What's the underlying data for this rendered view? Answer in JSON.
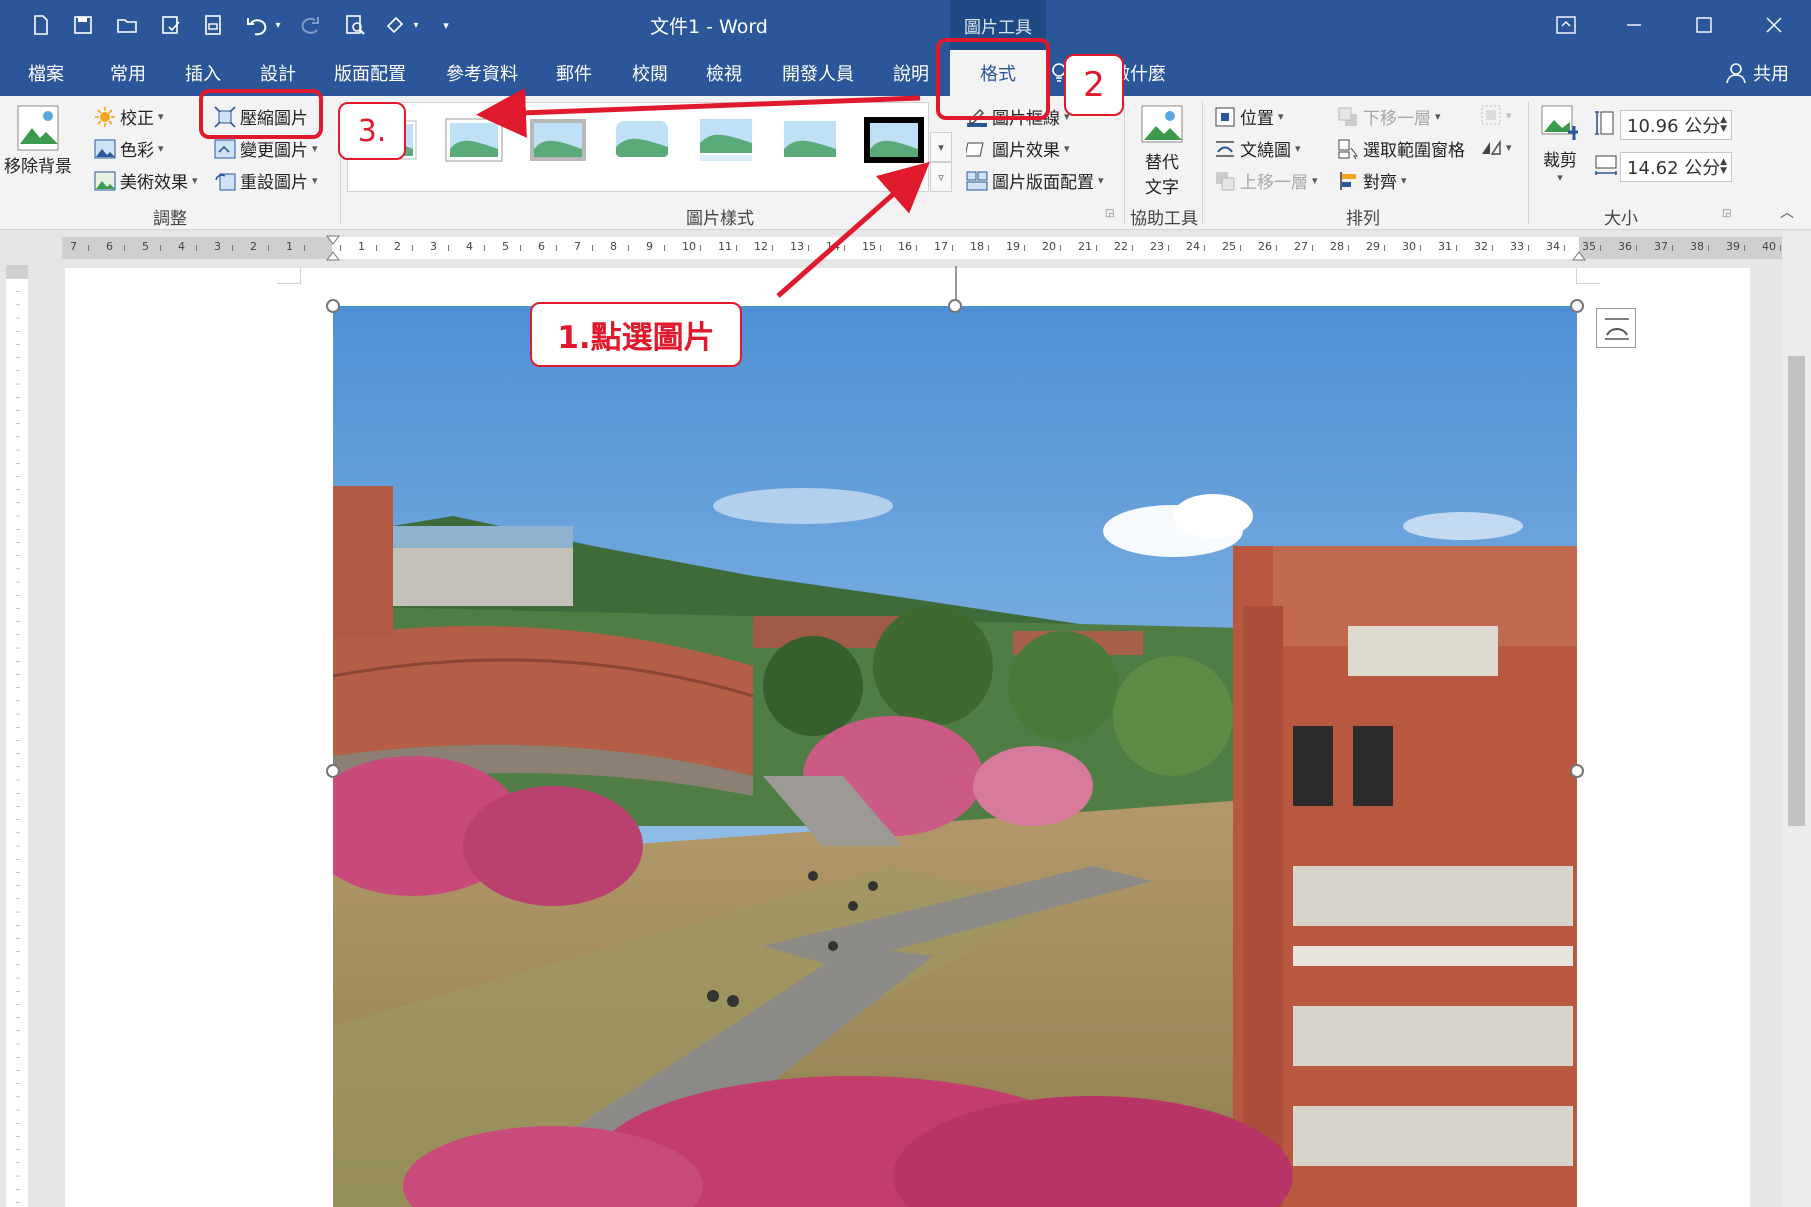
{
  "app": {
    "document_title": "文件1  -  Word",
    "tool_context": "圖片工具"
  },
  "tabs": [
    "檔案",
    "常用",
    "插入",
    "設計",
    "版面配置",
    "參考資料",
    "郵件",
    "校閱",
    "檢視",
    "開發人員",
    "說明",
    "格式"
  ],
  "active_tab": "格式",
  "tell_me": "您想做什麼",
  "share": "共用",
  "ribbon": {
    "adjust": {
      "remove_background": "移除背景",
      "corrections": "校正",
      "color": "色彩",
      "artistic": "美術效果",
      "compress": "壓縮圖片",
      "change": "變更圖片",
      "reset": "重設圖片",
      "label": "調整"
    },
    "styles": {
      "label": "圖片樣式",
      "border": "圖片框線",
      "effects": "圖片效果",
      "layout": "圖片版面配置"
    },
    "accessibility": {
      "alt_text_line1": "替代",
      "alt_text_line2": "文字",
      "label": "協助工具"
    },
    "arrange": {
      "position": "位置",
      "wrap": "文繞圖",
      "bring_forward": "上移一層",
      "send_backward": "下移一層",
      "selection_pane": "選取範圍窗格",
      "align": "對齊",
      "label": "排列"
    },
    "size": {
      "crop": "裁剪",
      "height": "10.96 公分",
      "width": "14.62 公分",
      "label": "大小"
    }
  },
  "ruler_numbers": [
    "7",
    "6",
    "5",
    "4",
    "3",
    "2",
    "1",
    "",
    "1",
    "2",
    "3",
    "4",
    "5",
    "6",
    "7",
    "8",
    "9",
    "10",
    "11",
    "12",
    "13",
    "14",
    "15",
    "16",
    "17",
    "18",
    "19",
    "20",
    "21",
    "22",
    "23",
    "24",
    "25",
    "26",
    "27",
    "28",
    "29",
    "30",
    "31",
    "32",
    "33",
    "34",
    "35",
    "36",
    "37",
    "38",
    "39",
    "40"
  ],
  "callouts": {
    "step1": "1.點選圖片",
    "step2": "2",
    "step3": "3."
  },
  "colors": {
    "title_bar": "#2b579a",
    "callout": "#e0192c"
  }
}
